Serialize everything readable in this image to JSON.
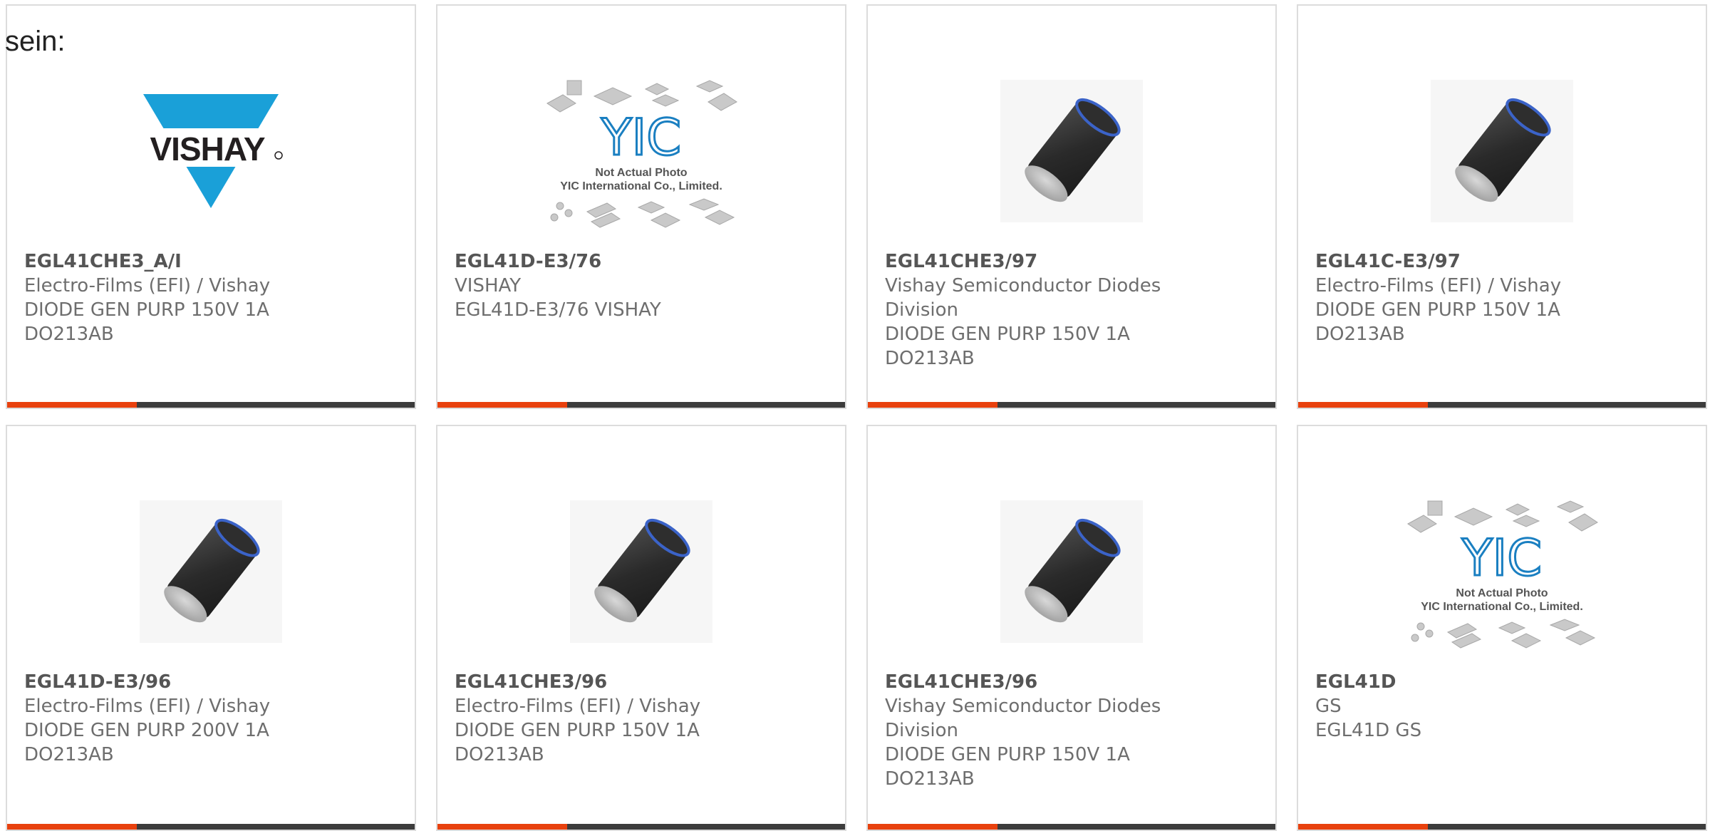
{
  "page": {
    "heading": "sein:"
  },
  "colors": {
    "accent": "#e8410e",
    "bar": "#3c3c3c",
    "vishay_blue": "#1aa0d8",
    "yic_blue": "#1a7fc1"
  },
  "products": [
    {
      "part": "EGL41CHE3_A/I",
      "lines": [
        "Electro-Films (EFI) / Vishay",
        "DIODE GEN PURP 150V 1A",
        "DO213AB"
      ],
      "image": "vishay-logo"
    },
    {
      "part": "EGL41D-E3/76",
      "lines": [
        "VISHAY",
        "EGL41D-E3/76 VISHAY"
      ],
      "image": "yic-placeholder"
    },
    {
      "part": "EGL41CHE3/97",
      "lines": [
        "Vishay Semiconductor Diodes",
        "Division",
        "DIODE GEN PURP 150V 1A",
        "DO213AB"
      ],
      "image": "diode-package"
    },
    {
      "part": "EGL41C-E3/97",
      "lines": [
        "Electro-Films (EFI) / Vishay",
        "DIODE GEN PURP 150V 1A",
        "DO213AB"
      ],
      "image": "diode-package"
    },
    {
      "part": "EGL41D-E3/96",
      "lines": [
        "Electro-Films (EFI) / Vishay",
        "DIODE GEN PURP 200V 1A",
        "DO213AB"
      ],
      "image": "diode-package"
    },
    {
      "part": "EGL41CHE3/96",
      "lines": [
        "Electro-Films (EFI) / Vishay",
        "DIODE GEN PURP 150V 1A",
        "DO213AB"
      ],
      "image": "diode-package"
    },
    {
      "part": "EGL41CHE3/96",
      "lines": [
        "Vishay Semiconductor Diodes",
        "Division",
        "DIODE GEN PURP 150V 1A",
        "DO213AB"
      ],
      "image": "diode-package"
    },
    {
      "part": "EGL41D",
      "lines": [
        "GS",
        "EGL41D GS"
      ],
      "image": "yic-placeholder"
    }
  ],
  "images": {
    "vishay_logo_text": "VISHAY",
    "yic_logo_text": "YIC",
    "yic_caption_1": "Not Actual Photo",
    "yic_caption_2": "YIC International Co., Limited."
  }
}
